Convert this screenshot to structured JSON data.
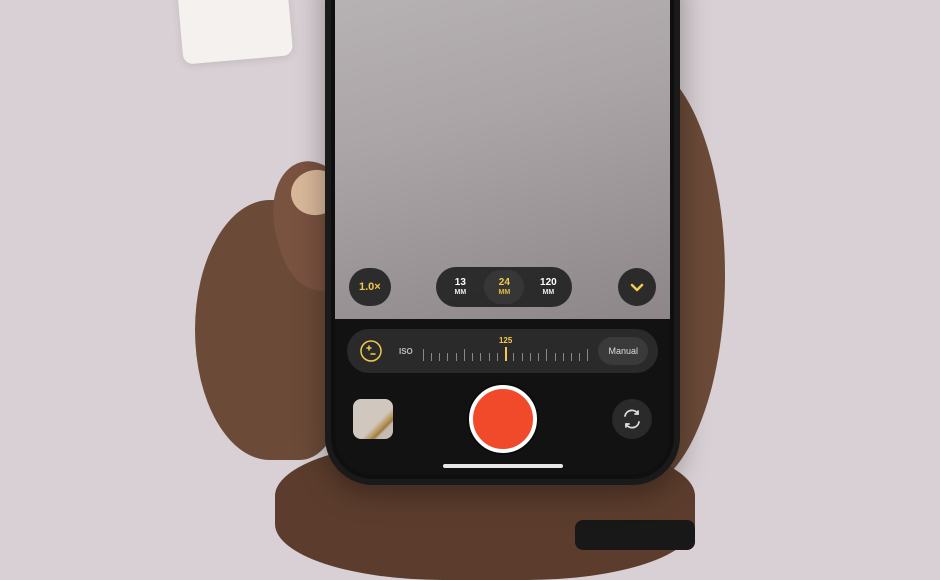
{
  "zoom": {
    "label": "1.0×"
  },
  "lenses": [
    {
      "focal": "13",
      "unit": "MM",
      "active": false
    },
    {
      "focal": "24",
      "unit": "MM",
      "active": true
    },
    {
      "focal": "120",
      "unit": "MM",
      "active": false
    }
  ],
  "iso": {
    "label": "ISO",
    "value": "125"
  },
  "mode": {
    "manual_label": "Manual"
  }
}
